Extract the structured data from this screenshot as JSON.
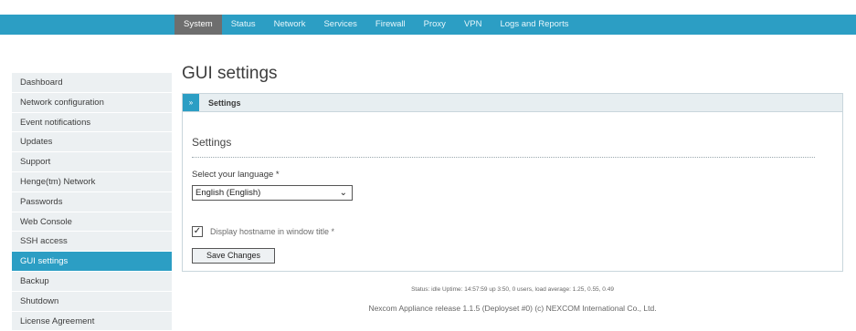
{
  "topnav": {
    "items": [
      "System",
      "Status",
      "Network",
      "Services",
      "Firewall",
      "Proxy",
      "VPN",
      "Logs and Reports"
    ],
    "active_index": 0
  },
  "sidebar": {
    "items": [
      "Dashboard",
      "Network configuration",
      "Event notifications",
      "Updates",
      "Support",
      "Henge(tm) Network",
      "Passwords",
      "Web Console",
      "SSH access",
      "GUI settings",
      "Backup",
      "Shutdown",
      "License Agreement"
    ],
    "active_index": 9
  },
  "page": {
    "title": "GUI settings"
  },
  "panel": {
    "header_toggle": "»",
    "header_title": "Settings",
    "section_title": "Settings",
    "language_label": "Select your language *",
    "language_value": "English (English)",
    "hostname_checked": true,
    "hostname_label": "Display hostname in window title *",
    "save_label": "Save Changes"
  },
  "footer": {
    "status": "Status: idle Uptime: 14:57:59 up 3:50, 0 users, load average: 1.25, 0.55, 0.49",
    "release": "Nexcom Appliance release 1.1.5 (Deployset #0) (c) NEXCOM International Co., Ltd."
  },
  "colors": {
    "accent": "#2c9ec4",
    "active_tab": "#6e6e6e",
    "sidebar_bg": "#ecf0f2"
  }
}
